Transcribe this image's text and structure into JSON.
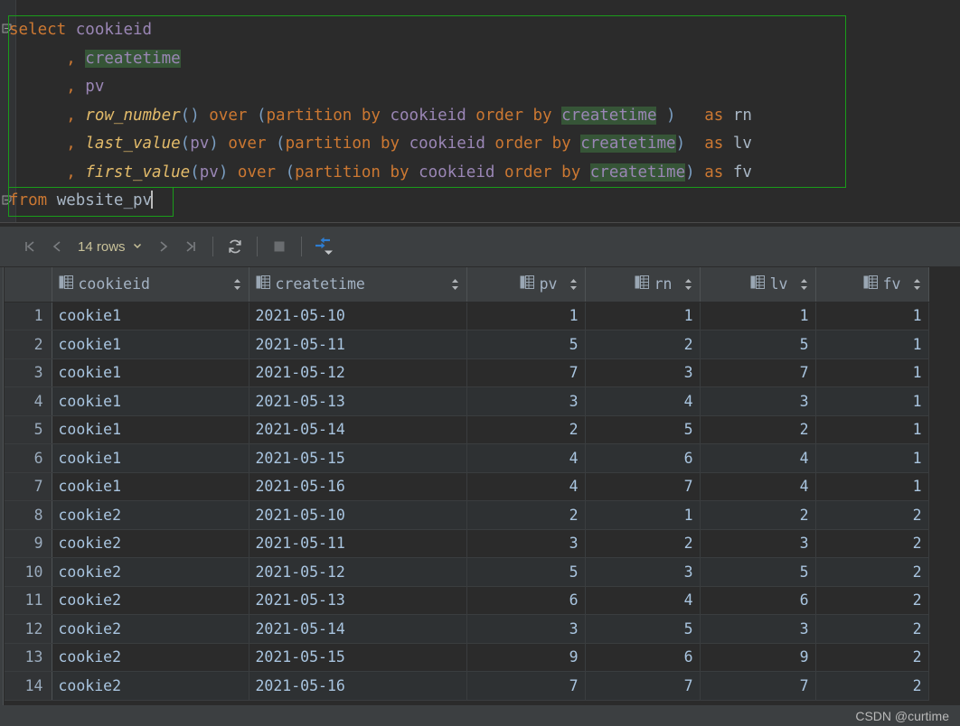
{
  "editor": {
    "lines": [
      [
        {
          "t": "select",
          "c": "kw"
        },
        {
          "t": " ",
          "c": "plain"
        },
        {
          "t": "cookieid",
          "c": "ident"
        }
      ],
      [
        {
          "t": "      ",
          "c": "plain"
        },
        {
          "t": ", ",
          "c": "kw"
        },
        {
          "t": "createtime",
          "c": "ident",
          "hl": true
        }
      ],
      [
        {
          "t": "      ",
          "c": "plain"
        },
        {
          "t": ", ",
          "c": "kw"
        },
        {
          "t": "pv",
          "c": "ident"
        }
      ],
      [
        {
          "t": "      ",
          "c": "plain"
        },
        {
          "t": ", ",
          "c": "kw"
        },
        {
          "t": "row_number",
          "c": "fn"
        },
        {
          "t": "()",
          "c": "punc"
        },
        {
          "t": " over ",
          "c": "kw"
        },
        {
          "t": "(",
          "c": "punc"
        },
        {
          "t": "partition by ",
          "c": "kw"
        },
        {
          "t": "cookieid",
          "c": "ident"
        },
        {
          "t": " order by ",
          "c": "kw"
        },
        {
          "t": "createtime",
          "c": "ident",
          "hl": true
        },
        {
          "t": " ",
          "c": "plain"
        },
        {
          "t": ")",
          "c": "punc"
        },
        {
          "t": "   ",
          "c": "plain"
        },
        {
          "t": "as",
          "c": "kw"
        },
        {
          "t": " ",
          "c": "plain"
        },
        {
          "t": "rn",
          "c": "plain"
        }
      ],
      [
        {
          "t": "      ",
          "c": "plain"
        },
        {
          "t": ", ",
          "c": "kw"
        },
        {
          "t": "last_value",
          "c": "fn"
        },
        {
          "t": "(",
          "c": "punc"
        },
        {
          "t": "pv",
          "c": "ident"
        },
        {
          "t": ")",
          "c": "punc"
        },
        {
          "t": " over ",
          "c": "kw"
        },
        {
          "t": "(",
          "c": "punc"
        },
        {
          "t": "partition by ",
          "c": "kw"
        },
        {
          "t": "cookieid",
          "c": "ident"
        },
        {
          "t": " order by ",
          "c": "kw"
        },
        {
          "t": "createtime",
          "c": "ident",
          "hl": true
        },
        {
          "t": ")",
          "c": "punc"
        },
        {
          "t": "  ",
          "c": "plain"
        },
        {
          "t": "as",
          "c": "kw"
        },
        {
          "t": " ",
          "c": "plain"
        },
        {
          "t": "lv",
          "c": "plain"
        }
      ],
      [
        {
          "t": "      ",
          "c": "plain"
        },
        {
          "t": ", ",
          "c": "kw"
        },
        {
          "t": "first_value",
          "c": "fn"
        },
        {
          "t": "(",
          "c": "punc"
        },
        {
          "t": "pv",
          "c": "ident"
        },
        {
          "t": ")",
          "c": "punc"
        },
        {
          "t": " over ",
          "c": "kw"
        },
        {
          "t": "(",
          "c": "punc"
        },
        {
          "t": "partition by ",
          "c": "kw"
        },
        {
          "t": "cookieid",
          "c": "ident"
        },
        {
          "t": " order by ",
          "c": "kw"
        },
        {
          "t": "createtime",
          "c": "ident",
          "hl": true
        },
        {
          "t": ")",
          "c": "punc"
        },
        {
          "t": " ",
          "c": "plain"
        },
        {
          "t": "as",
          "c": "kw"
        },
        {
          "t": " ",
          "c": "plain"
        },
        {
          "t": "fv",
          "c": "plain"
        }
      ],
      [
        {
          "t": "from",
          "c": "kw"
        },
        {
          "t": " ",
          "c": "plain"
        },
        {
          "t": "website_pv",
          "c": "plain"
        },
        {
          "t": "",
          "c": "caret"
        }
      ]
    ],
    "plain_text": "select cookieid\n      , createtime\n      , pv\n      , row_number() over (partition by cookieid order by createtime )   as rn\n      , last_value(pv) over (partition by cookieid order by createtime)  as lv\n      , first_value(pv) over (partition by cookieid order by createtime) as fv\nfrom website_pv",
    "selection_border_color": "#1a9c1a",
    "highlight_color": "#365537"
  },
  "toolbar": {
    "first_page": "first-page",
    "prev_page": "previous-page",
    "rows_label": "14 rows",
    "next_page": "next-page",
    "last_page": "last-page",
    "reload": "reload",
    "stop": "stop",
    "transpose": "transpose"
  },
  "table": {
    "columns": [
      {
        "label": "cookieid",
        "align": "left"
      },
      {
        "label": "createtime",
        "align": "left"
      },
      {
        "label": "pv",
        "align": "right"
      },
      {
        "label": "rn",
        "align": "right"
      },
      {
        "label": "lv",
        "align": "right"
      },
      {
        "label": "fv",
        "align": "right"
      }
    ],
    "rows": [
      {
        "n": "1",
        "cookieid": "cookie1",
        "createtime": "2021-05-10",
        "pv": "1",
        "rn": "1",
        "lv": "1",
        "fv": "1"
      },
      {
        "n": "2",
        "cookieid": "cookie1",
        "createtime": "2021-05-11",
        "pv": "5",
        "rn": "2",
        "lv": "5",
        "fv": "1"
      },
      {
        "n": "3",
        "cookieid": "cookie1",
        "createtime": "2021-05-12",
        "pv": "7",
        "rn": "3",
        "lv": "7",
        "fv": "1"
      },
      {
        "n": "4",
        "cookieid": "cookie1",
        "createtime": "2021-05-13",
        "pv": "3",
        "rn": "4",
        "lv": "3",
        "fv": "1"
      },
      {
        "n": "5",
        "cookieid": "cookie1",
        "createtime": "2021-05-14",
        "pv": "2",
        "rn": "5",
        "lv": "2",
        "fv": "1"
      },
      {
        "n": "6",
        "cookieid": "cookie1",
        "createtime": "2021-05-15",
        "pv": "4",
        "rn": "6",
        "lv": "4",
        "fv": "1"
      },
      {
        "n": "7",
        "cookieid": "cookie1",
        "createtime": "2021-05-16",
        "pv": "4",
        "rn": "7",
        "lv": "4",
        "fv": "1"
      },
      {
        "n": "8",
        "cookieid": "cookie2",
        "createtime": "2021-05-10",
        "pv": "2",
        "rn": "1",
        "lv": "2",
        "fv": "2"
      },
      {
        "n": "9",
        "cookieid": "cookie2",
        "createtime": "2021-05-11",
        "pv": "3",
        "rn": "2",
        "lv": "3",
        "fv": "2"
      },
      {
        "n": "10",
        "cookieid": "cookie2",
        "createtime": "2021-05-12",
        "pv": "5",
        "rn": "3",
        "lv": "5",
        "fv": "2"
      },
      {
        "n": "11",
        "cookieid": "cookie2",
        "createtime": "2021-05-13",
        "pv": "6",
        "rn": "4",
        "lv": "6",
        "fv": "2"
      },
      {
        "n": "12",
        "cookieid": "cookie2",
        "createtime": "2021-05-14",
        "pv": "3",
        "rn": "5",
        "lv": "3",
        "fv": "2"
      },
      {
        "n": "13",
        "cookieid": "cookie2",
        "createtime": "2021-05-15",
        "pv": "9",
        "rn": "6",
        "lv": "9",
        "fv": "2"
      },
      {
        "n": "14",
        "cookieid": "cookie2",
        "createtime": "2021-05-16",
        "pv": "7",
        "rn": "7",
        "lv": "7",
        "fv": "2"
      }
    ]
  },
  "status": {
    "watermark": "CSDN @curtime"
  }
}
